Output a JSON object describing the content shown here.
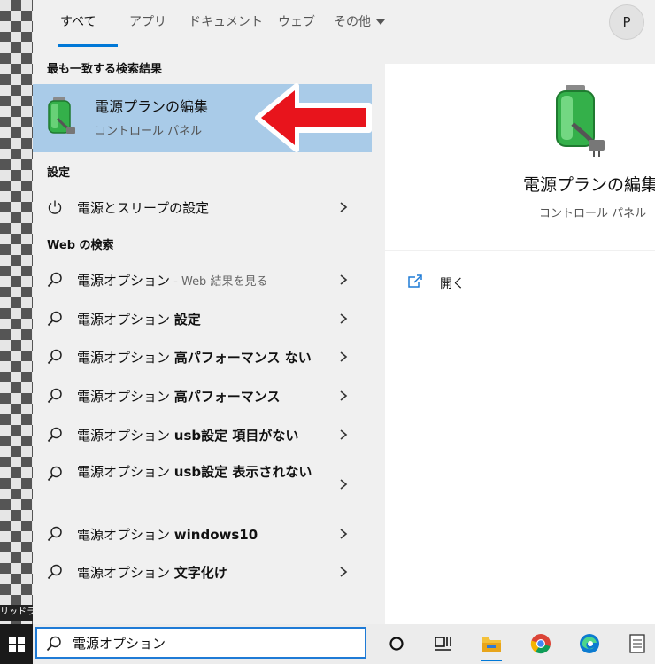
{
  "desktop": {
    "label": "リッドラ"
  },
  "tabs": [
    {
      "label": "すべて"
    },
    {
      "label": "アプリ"
    },
    {
      "label": "ドキュメント"
    },
    {
      "label": "ウェブ"
    },
    {
      "label": "その他"
    }
  ],
  "user": {
    "avatar_letter": "P"
  },
  "best_match": {
    "section_title": "最も一致する検索結果",
    "title": "電源プランの編集",
    "subtitle": "コントロール パネル"
  },
  "settings": {
    "section_title": "設定",
    "items": [
      {
        "label": "電源とスリープの設定"
      }
    ]
  },
  "web": {
    "section_title": "Web の検索",
    "first": {
      "query": "電源オプション",
      "hint": " - Web 結果を見る"
    },
    "items": [
      {
        "prefix": "電源オプション ",
        "bold": "設定"
      },
      {
        "prefix": "電源オプション ",
        "bold": "高パフォーマンス ない"
      },
      {
        "prefix": "電源オプション ",
        "bold": "高パフォーマンス"
      },
      {
        "prefix": "電源オプション ",
        "bold": "usb設定 項目がない"
      },
      {
        "prefix": "電源オプション ",
        "bold": "usb設定 表示されない"
      },
      {
        "prefix": "電源オプション ",
        "bold": "windows10"
      },
      {
        "prefix": "電源オプション ",
        "bold": "文字化け"
      }
    ]
  },
  "detail": {
    "title": "電源プランの編集",
    "subtitle": "コントロール パネル",
    "open_label": "開く"
  },
  "taskbar": {
    "search_value": "電源オプション",
    "icons": [
      "cortana-icon",
      "task-view-icon",
      "file-explorer-icon",
      "chrome-icon",
      "edge-icon",
      "notepad-icon"
    ]
  },
  "colors": {
    "accent": "#0078d7",
    "selected_bg": "#a9cbe8",
    "arrow_red": "#e8141c"
  }
}
